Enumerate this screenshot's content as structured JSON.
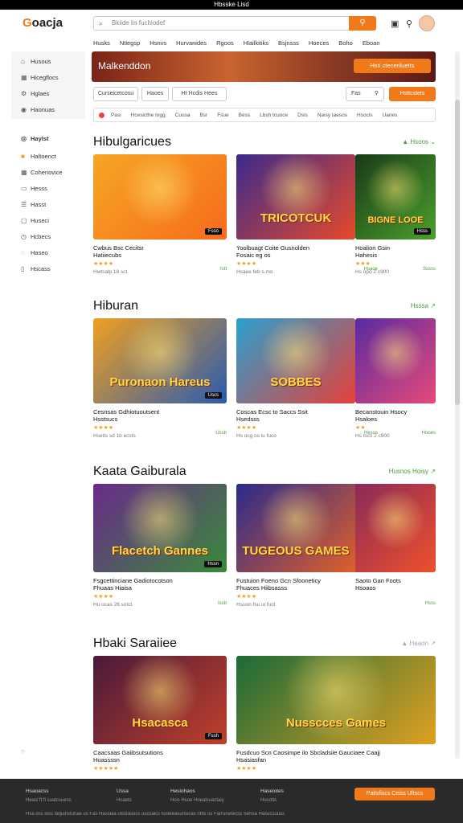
{
  "statusbar": {
    "title": "Hbsske Lisd"
  },
  "header": {
    "logo_prefix": "G",
    "logo_rest": "oacja",
    "search_placeholder": "Bkiide lis fuchiodef",
    "nav": [
      "Husks",
      "Ntiegsp",
      "Hsnvs",
      "Hurvanides",
      "Rgoos",
      "Hlailkitiks",
      "Bsjnsss",
      "Hoeces",
      "Boho",
      "Eboan"
    ]
  },
  "sidebar": {
    "top_items": [
      {
        "icon": "home-icon",
        "label": "Husous"
      },
      {
        "icon": "grid-icon",
        "label": "Hicegflocs"
      },
      {
        "icon": "settings-icon",
        "label": "Hglaes"
      },
      {
        "icon": "user-icon",
        "label": "Haonuas"
      }
    ],
    "group_title": "Haylst",
    "items": [
      {
        "icon": "star-icon",
        "label": "Haltoenct"
      },
      {
        "icon": "grid-icon",
        "label": "Coheriovice"
      },
      {
        "icon": "folder-icon",
        "label": "Hesss"
      },
      {
        "icon": "list-icon",
        "label": "Hasst"
      },
      {
        "icon": "cart-icon",
        "label": "Huseci"
      },
      {
        "icon": "clock-icon",
        "label": "Hcbecs"
      },
      {
        "icon": "tag-icon",
        "label": "Haseo"
      },
      {
        "icon": "info-icon",
        "label": "Hscass"
      }
    ]
  },
  "banner": {
    "title": "Malkenddon",
    "button": "Hsti cteceriluetts"
  },
  "filters": {
    "buttons": [
      "Curseicetcosu",
      "Haoes",
      "Ht Hcdis Hees"
    ],
    "right_button": "Fas",
    "action_button": "Hsttcstets"
  },
  "chips": [
    "Pasi",
    "Hcesicthe Ingg",
    "Cuusa",
    "Bsr",
    "Fsue",
    "Bess",
    "Lbsh tcuoce",
    "Dsis",
    "Naisy Iaesos",
    "Hsocis",
    "Uanes"
  ],
  "sections": [
    {
      "title": "Hibulgaricues",
      "more": "Hsoos",
      "cards": [
        {
          "art": "",
          "tag": "Fsso",
          "title": "Cwbus Bsc Cecitsr",
          "sub": "Hatiiecubs",
          "stars": "★★★★",
          "meta": "Hwtsalp 18 sct",
          "price": "Istt",
          "colors": [
            "#f5a623",
            "#f76b1c"
          ]
        },
        {
          "art": "TRICOTCUK",
          "tag": "",
          "title": "Yoolbuagt Coite Gusnolden",
          "sub": "Fosaic eg os",
          "stars": "★★★★",
          "meta": "Hsaee feb s.mo",
          "price": "Hsaoe",
          "colors": [
            "#3b2a8c",
            "#e64a2a"
          ]
        },
        {
          "art": "BIGNE LOOE",
          "tag": "Hsss",
          "title": "Hoalion Gsin",
          "sub": "Hahesis",
          "stars": "★★★",
          "meta": "Hs opo 2 c900",
          "price": "Sssss",
          "colors": [
            "#1a3a1a",
            "#4aa02a"
          ]
        }
      ]
    },
    {
      "title": "Hiburan",
      "more": "Hsssa",
      "cards": [
        {
          "art": "Puronaon Hareus",
          "tag": "Uscs",
          "title": "Cesnsas Gdhiotuoutsent",
          "sub": "Hsstsucs",
          "stars": "★★★★",
          "meta": "Hsetis sd 1b ecsts",
          "price": "Ussb",
          "colors": [
            "#f0a020",
            "#2a5ab0"
          ]
        },
        {
          "art": "SOBBES",
          "tag": "",
          "title": "Coscas Ecsc to Saccs Ssit",
          "sub": "Hsedsss",
          "stars": "★★★★",
          "meta": "Hs ocg os iu fuco",
          "price": "Hesos",
          "colors": [
            "#2aa0d0",
            "#e6403a"
          ]
        },
        {
          "art": "",
          "tag": "",
          "title": "Becanstouin Hsocy",
          "sub": "Hsaloes",
          "stars": "★★",
          "meta": "Hs tscs 2 c900",
          "price": "Hooes",
          "colors": [
            "#5a2aa0",
            "#e64a7a"
          ]
        }
      ]
    },
    {
      "title": "Kaata Gaiburala",
      "more": "Husnos Hoisy",
      "cards": [
        {
          "art": "Flacetch Gannes",
          "tag": "Hssn",
          "title": "Fsgcettinciane Gadiotocotson",
          "sub": "Fhuaas Hiaisa",
          "stars": "★★★★",
          "meta": "Hu ocas 26 sotct",
          "price": "Issb",
          "colors": [
            "#6a2a8a",
            "#3a8a3a"
          ]
        },
        {
          "art": "TUGEOUS GAMES",
          "tag": "",
          "title": "Fustuion Foeno Gcn Sfooneticy",
          "sub": "Fhuaces Hiibsasss",
          "stars": "★★★★",
          "meta": "Hsuon fsu iu fuct",
          "price": "Hoos",
          "colors": [
            "#2a2a8c",
            "#e0602a"
          ]
        },
        {
          "art": "",
          "tag": "",
          "title": "Saoto Gan Foots",
          "sub": "Hsoaos",
          "stars": "",
          "meta": "",
          "price": "Hsss",
          "colors": [
            "#8a2a5a",
            "#f0502a"
          ]
        }
      ]
    },
    {
      "title": "Hbaki Saraiiee",
      "more": "Haaon",
      "cards": [
        {
          "art": "Hsacasca",
          "tag": "Fssh",
          "title": "Caacsaas Gaiibsutsutions",
          "sub": "Huassssn",
          "stars": "★★★★★",
          "meta": "",
          "price": "",
          "colors": [
            "#4a1a3a",
            "#c0402a"
          ]
        },
        {
          "art": "Nusscces Games",
          "tag": "",
          "title": "Fusdcuo Scn Caosimpe ilo Sbcladsiie Gauciaee Caajj",
          "sub": "Hsasiasfan",
          "stars": "★★★★",
          "meta": "",
          "price": "",
          "colors": [
            "#1a6a3a",
            "#e0a020"
          ]
        }
      ]
    }
  ],
  "footer": {
    "col1_title": "Hsaoacss",
    "col1_text": "Heasi ft fi suatcsuess",
    "col2_title": "Ussa",
    "col2_text": "Hcaets",
    "col3_title": "Hesiohaos",
    "col3_text": "Hcis Hsoe Hoealsuactaiy",
    "col4_title": "Haseiotes",
    "col4_text": "Husotis",
    "button": "Paitsfiscs Ceiss Uftscs",
    "bottom_text": "Hsa oss loss tarjuinstutuai us Fas Hassiaa ulsstasucs uscsalcs fusteeasunsicas rifits us Farrunetecss Sehsa Hasucsuuss"
  }
}
